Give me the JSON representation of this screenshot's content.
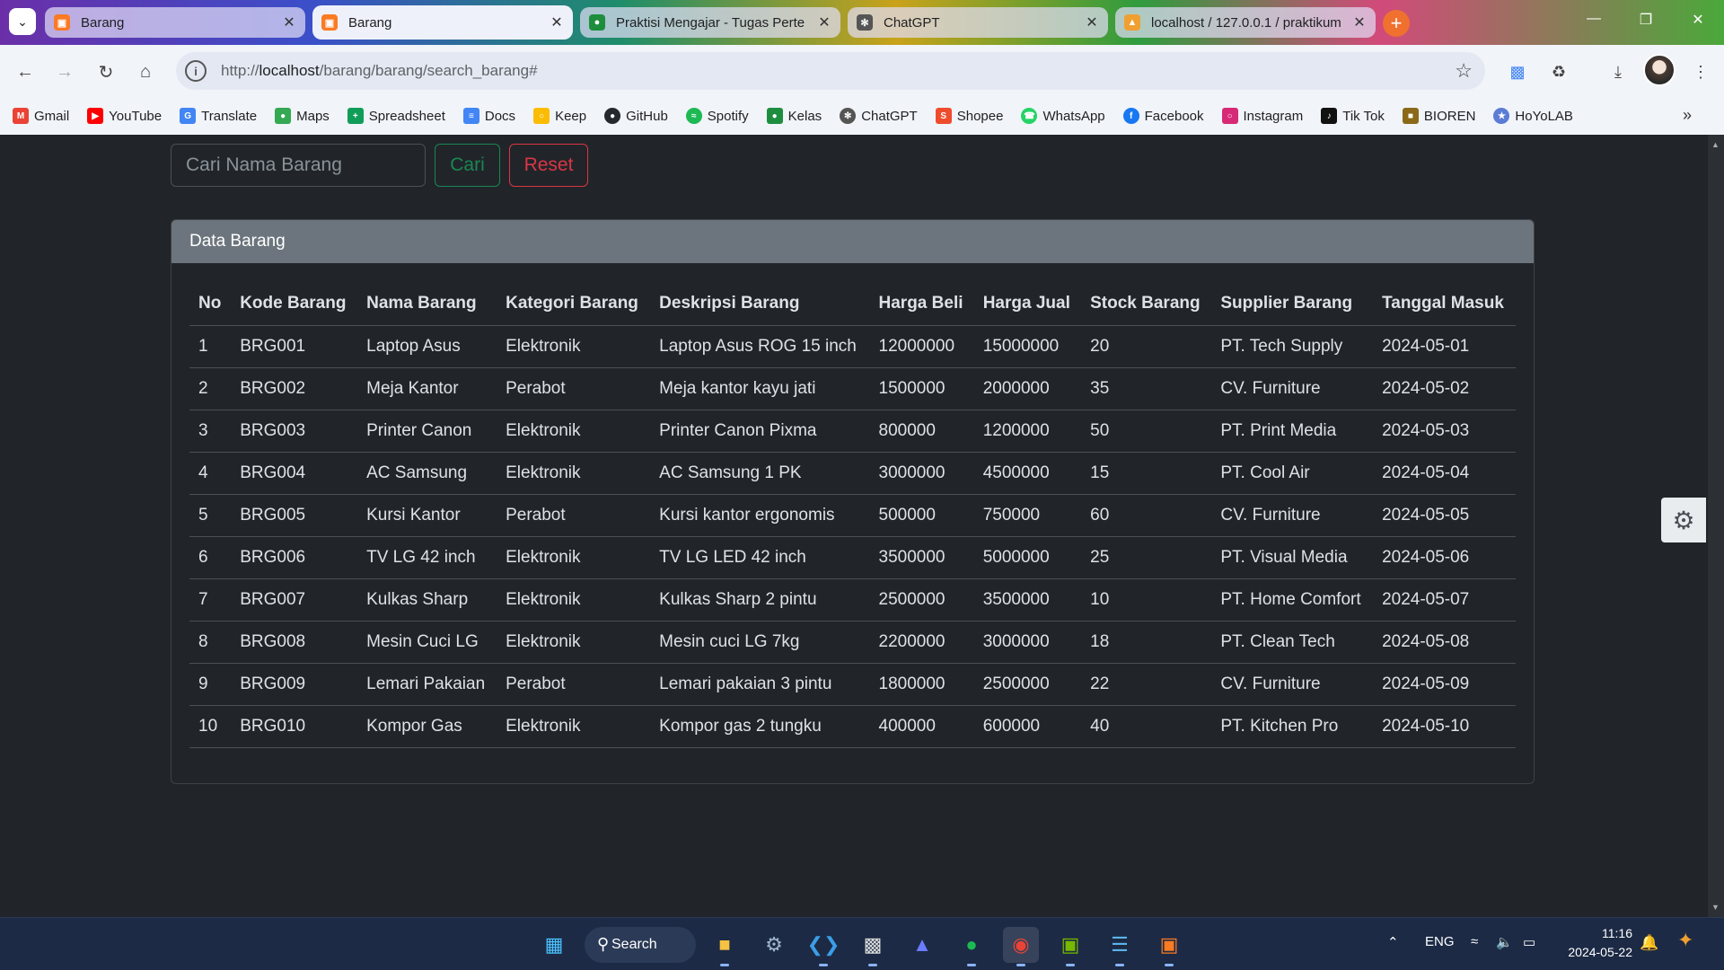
{
  "browser": {
    "tabs": [
      {
        "title": "Barang",
        "favicon": "xampp-icon",
        "color": "#fb7a24"
      },
      {
        "title": "Barang",
        "favicon": "xampp-icon",
        "color": "#fb7a24"
      },
      {
        "title": "Praktisi Mengajar - Tugas Perte",
        "favicon": "classroom-icon",
        "color": "#1e8e3e"
      },
      {
        "title": "ChatGPT",
        "favicon": "chatgpt-icon",
        "color": "#555555"
      },
      {
        "title": "localhost / 127.0.0.1 / praktikum",
        "favicon": "phpmyadmin-icon",
        "color": "#f0a030"
      }
    ],
    "new_tab_label": "+",
    "url_prefix": "http://",
    "url_host": "localhost",
    "url_path": "/barang/barang/search_barang#",
    "bookmarks": [
      {
        "label": "Gmail",
        "icon": "gmail-icon",
        "color": "#ea4335"
      },
      {
        "label": "YouTube",
        "icon": "youtube-icon",
        "color": "#ff0000"
      },
      {
        "label": "Translate",
        "icon": "translate-icon",
        "color": "#4285f4"
      },
      {
        "label": "Maps",
        "icon": "maps-icon",
        "color": "#34a853"
      },
      {
        "label": "Spreadsheet",
        "icon": "sheets-icon",
        "color": "#0f9d58"
      },
      {
        "label": "Docs",
        "icon": "docs-icon",
        "color": "#4285f4"
      },
      {
        "label": "Keep",
        "icon": "keep-icon",
        "color": "#fbbc04"
      },
      {
        "label": "GitHub",
        "icon": "github-icon",
        "color": "#24292f"
      },
      {
        "label": "Spotify",
        "icon": "spotify-icon",
        "color": "#1db954"
      },
      {
        "label": "Kelas",
        "icon": "classroom-icon",
        "color": "#1e8e3e"
      },
      {
        "label": "ChatGPT",
        "icon": "chatgpt-icon",
        "color": "#555555"
      },
      {
        "label": "Shopee",
        "icon": "shopee-icon",
        "color": "#ee4d2d"
      },
      {
        "label": "WhatsApp",
        "icon": "whatsapp-icon",
        "color": "#25d366"
      },
      {
        "label": "Facebook",
        "icon": "facebook-icon",
        "color": "#1877f2"
      },
      {
        "label": "Instagram",
        "icon": "instagram-icon",
        "color": "#d62976"
      },
      {
        "label": "Tik Tok",
        "icon": "tiktok-icon",
        "color": "#111111"
      },
      {
        "label": "BIOREN",
        "icon": "bioren-icon",
        "color": "#8a6a1a"
      },
      {
        "label": "HoYoLAB",
        "icon": "hoyolab-icon",
        "color": "#5b7bd5"
      }
    ]
  },
  "search": {
    "placeholder": "Cari Nama Barang",
    "search_label": "Cari",
    "reset_label": "Reset"
  },
  "card": {
    "title": "Data Barang",
    "columns": [
      "No",
      "Kode Barang",
      "Nama Barang",
      "Kategori Barang",
      "Deskripsi Barang",
      "Harga Beli",
      "Harga Jual",
      "Stock Barang",
      "Supplier Barang",
      "Tanggal Masuk"
    ],
    "rows": [
      [
        "1",
        "BRG001",
        "Laptop Asus",
        "Elektronik",
        "Laptop Asus ROG 15 inch",
        "12000000",
        "15000000",
        "20",
        "PT. Tech Supply",
        "2024-05-01"
      ],
      [
        "2",
        "BRG002",
        "Meja Kantor",
        "Perabot",
        "Meja kantor kayu jati",
        "1500000",
        "2000000",
        "35",
        "CV. Furniture",
        "2024-05-02"
      ],
      [
        "3",
        "BRG003",
        "Printer Canon",
        "Elektronik",
        "Printer Canon Pixma",
        "800000",
        "1200000",
        "50",
        "PT. Print Media",
        "2024-05-03"
      ],
      [
        "4",
        "BRG004",
        "AC Samsung",
        "Elektronik",
        "AC Samsung 1 PK",
        "3000000",
        "4500000",
        "15",
        "PT. Cool Air",
        "2024-05-04"
      ],
      [
        "5",
        "BRG005",
        "Kursi Kantor",
        "Perabot",
        "Kursi kantor ergonomis",
        "500000",
        "750000",
        "60",
        "CV. Furniture",
        "2024-05-05"
      ],
      [
        "6",
        "BRG006",
        "TV LG 42 inch",
        "Elektronik",
        "TV LG LED 42 inch",
        "3500000",
        "5000000",
        "25",
        "PT. Visual Media",
        "2024-05-06"
      ],
      [
        "7",
        "BRG007",
        "Kulkas Sharp",
        "Elektronik",
        "Kulkas Sharp 2 pintu",
        "2500000",
        "3500000",
        "10",
        "PT. Home Comfort",
        "2024-05-07"
      ],
      [
        "8",
        "BRG008",
        "Mesin Cuci LG",
        "Elektronik",
        "Mesin cuci LG 7kg",
        "2200000",
        "3000000",
        "18",
        "PT. Clean Tech",
        "2024-05-08"
      ],
      [
        "9",
        "BRG009",
        "Lemari Pakaian",
        "Perabot",
        "Lemari pakaian 3 pintu",
        "1800000",
        "2500000",
        "22",
        "CV. Furniture",
        "2024-05-09"
      ],
      [
        "10",
        "BRG010",
        "Kompor Gas",
        "Elektronik",
        "Kompor gas 2 tungku",
        "400000",
        "600000",
        "40",
        "PT. Kitchen Pro",
        "2024-05-10"
      ]
    ]
  },
  "colors": {
    "page_bg": "#212529",
    "success": "#198754",
    "danger": "#dc3545",
    "card_header": "#6c757d"
  },
  "taskbar": {
    "search_label": "Search",
    "language": "ENG",
    "time": "11:16",
    "date": "2024-05-22",
    "apps": [
      "start-icon",
      "file-explorer-icon",
      "settings-icon",
      "vscode-icon",
      "terminal-icon",
      "editor-icon",
      "spotify-icon",
      "chrome-icon",
      "nvidia-icon",
      "notepad-icon",
      "xampp-icon"
    ]
  }
}
